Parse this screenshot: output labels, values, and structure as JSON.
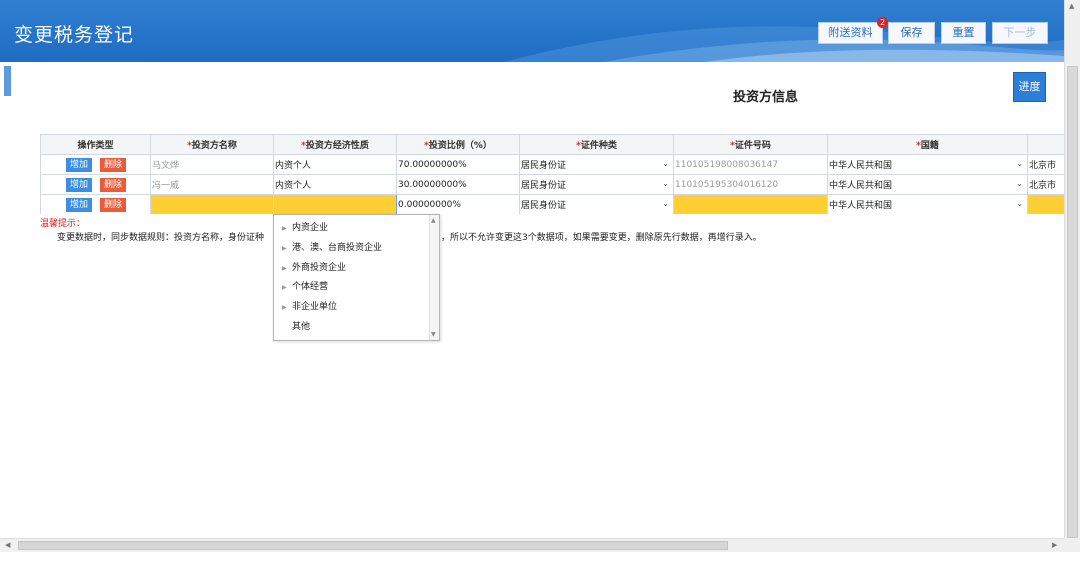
{
  "header": {
    "title": "变更税务登记",
    "buttons": {
      "attach": "附送资料",
      "attach_badge": "2",
      "save": "保存",
      "reset": "重置",
      "next": "下一步"
    }
  },
  "section": {
    "title": "投资方信息",
    "progress": "进度"
  },
  "table": {
    "columns": {
      "op": "操作类型",
      "name": "投资方名称",
      "nature": "投资方经济性质",
      "ratio": "投资比例（%）",
      "cert_type": "证件种类",
      "cert_no": "证件号码",
      "country": "国籍"
    },
    "required_mark": "*",
    "add_label": "增加",
    "delete_label": "删除",
    "rows": [
      {
        "name": "马文烨",
        "nature": "内资个人",
        "ratio": "70.00000000%",
        "cert_type": "居民身份证",
        "cert_no": "110105198008036147",
        "country": "中华人民共和国",
        "region": "北京市"
      },
      {
        "name": "冯一威",
        "nature": "内资个人",
        "ratio": "30.00000000%",
        "cert_type": "居民身份证",
        "cert_no": "110105195304016120",
        "country": "中华人民共和国",
        "region": "北京市"
      },
      {
        "name": "",
        "nature": "",
        "ratio": "0.00000000%",
        "cert_type": "居民身份证",
        "cert_no": "",
        "country": "中华人民共和国",
        "region": ""
      }
    ]
  },
  "tips": {
    "title": "温馨提示：",
    "text_left": "变更数据时，同步数据规则：投资方名称，身份证种",
    "text_right": "，所以不允许变更这3个数据项，如果需要变更，删除原先行数据，再增行录入。"
  },
  "dropdown": {
    "options": [
      {
        "label": "内资企业",
        "expandable": true
      },
      {
        "label": "港、澳、台商投资企业",
        "expandable": true
      },
      {
        "label": "外商投资企业",
        "expandable": true
      },
      {
        "label": "个体经营",
        "expandable": true
      },
      {
        "label": "非企业单位",
        "expandable": true
      },
      {
        "label": "其他",
        "expandable": false
      }
    ]
  },
  "colors": {
    "header_blue": "#1f6cc2",
    "add_blue": "#3b8ee2",
    "delete_red": "#e95b3a",
    "highlight_yellow": "#ffcf33",
    "required_red": "#e02020"
  }
}
